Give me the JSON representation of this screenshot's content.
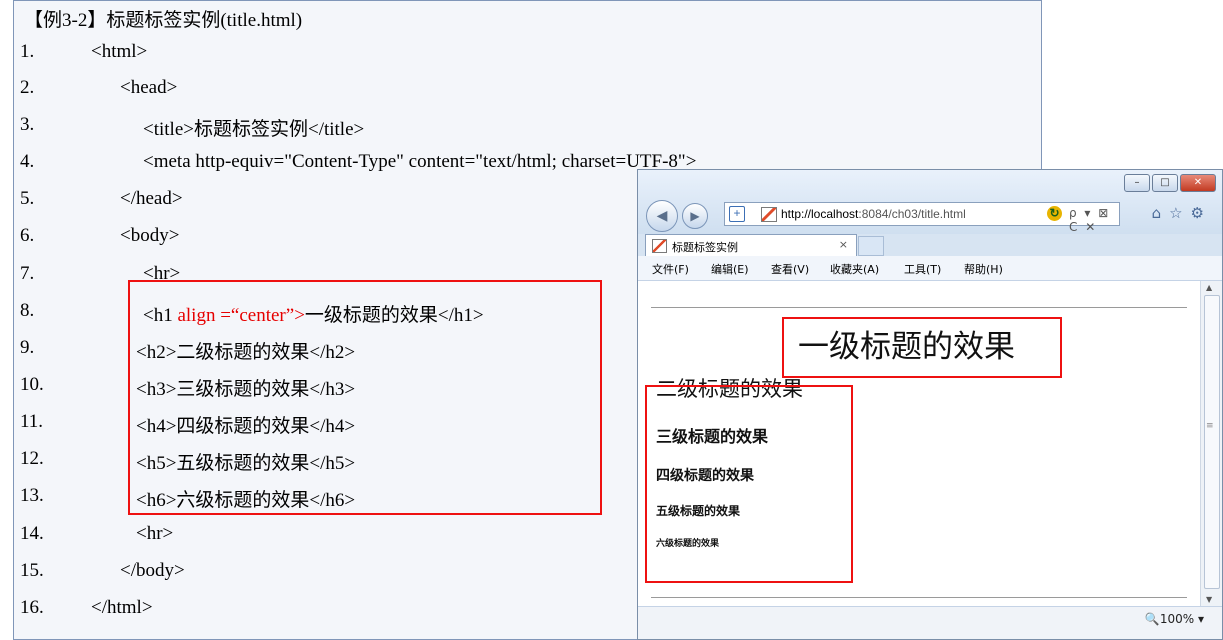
{
  "listing": {
    "title": "【例3-2】标题标签实例(title.html)",
    "lines": [
      {
        "num": "1.",
        "text": "<html>"
      },
      {
        "num": "2.",
        "text": "<head>"
      },
      {
        "num": "3.",
        "text": "<title>标题标签实例</title>"
      },
      {
        "num": "4.",
        "text": "<meta http-equiv=\"Content-Type\" content=\"text/html; charset=UTF-8\">"
      },
      {
        "num": "5.",
        "text": "</head>"
      },
      {
        "num": "6.",
        "text": "<body>"
      },
      {
        "num": "7.",
        "text": "<hr>"
      },
      {
        "num": "8.",
        "text_pre": "<h1 ",
        "text_red": "align =“center”>",
        "text_post": "一级标题的效果</h1>"
      },
      {
        "num": "9.",
        "text": "<h2>二级标题的效果</h2>"
      },
      {
        "num": "10.",
        "text": "<h3>三级标题的效果</h3>"
      },
      {
        "num": "11.",
        "text": "<h4>四级标题的效果</h4>"
      },
      {
        "num": "12.",
        "text": "<h5>五级标题的效果</h5>"
      },
      {
        "num": "13.",
        "text": "<h6>六级标题的效果</h6>"
      },
      {
        "num": "14.",
        "text": "<hr>"
      },
      {
        "num": "15.",
        "text": "</body>"
      },
      {
        "num": "16.",
        "text": "</html>"
      }
    ],
    "highlight_color": "#ee1111"
  },
  "browser": {
    "window_buttons": {
      "minimize": "–",
      "maximize": "□",
      "close": "✕"
    },
    "address": {
      "host": "http://localhost",
      "rest": ":8084/ch03/title.html",
      "controls": "ρ ▾ ⊠ C ✕"
    },
    "toolbar_icons": {
      "home": "⌂",
      "favorites": "☆",
      "settings": "⚙"
    },
    "tab": {
      "label": "标题标签实例",
      "close": "×"
    },
    "menu": [
      "文件(F)",
      "编辑(E)",
      "查看(V)",
      "收藏夹(A)",
      "工具(T)",
      "帮助(H)"
    ],
    "page": {
      "h1": "一级标题的效果",
      "h2": "二级标题的效果",
      "h3": "三级标题的效果",
      "h4": "四级标题的效果",
      "h5": "五级标题的效果",
      "h6": "六级标题的效果"
    },
    "status": {
      "zoom": "🔍100%  ▾"
    }
  }
}
